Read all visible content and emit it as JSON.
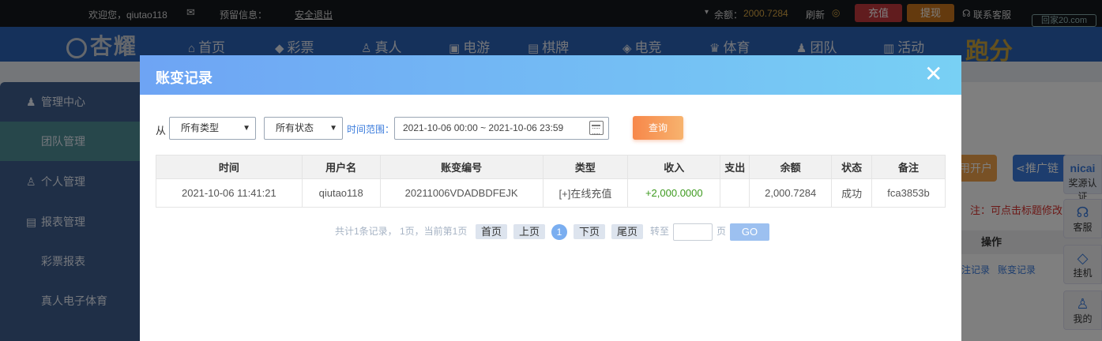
{
  "topbar": {
    "welcome": "欢迎您，qiutao118",
    "reserved_info": "预留信息：",
    "logout": "安全退出",
    "balance_label": "余额：",
    "balance_value": "2000.7284",
    "refresh": "刷新",
    "recharge": "充值",
    "withdraw": "提现",
    "support": "联系客服",
    "watermark": "回家20.com"
  },
  "nav": {
    "logo": "杏耀",
    "items": [
      {
        "label": "首页",
        "icon": "home-icon"
      },
      {
        "label": "彩票",
        "icon": "lottery-icon"
      },
      {
        "label": "真人",
        "icon": "live-icon"
      },
      {
        "label": "电游",
        "icon": "slots-icon"
      },
      {
        "label": "棋牌",
        "icon": "cards-icon"
      },
      {
        "label": "电竞",
        "icon": "gamepad-icon"
      },
      {
        "label": "体育",
        "icon": "trophy-icon"
      },
      {
        "label": "团队",
        "icon": "team-icon"
      },
      {
        "label": "活动",
        "icon": "gift-icon"
      }
    ],
    "run_score": "跑分"
  },
  "sidebar": {
    "items": [
      {
        "label": "管理中心",
        "icon": "users-icon"
      },
      {
        "label": "团队管理",
        "icon": ""
      },
      {
        "label": "个人管理",
        "icon": "user-icon"
      },
      {
        "label": "报表管理",
        "icon": "report-icon"
      },
      {
        "label": "彩票报表",
        "icon": ""
      },
      {
        "label": "真人电子体育",
        "icon": ""
      }
    ]
  },
  "background": {
    "open_account": "用开户",
    "promo": "推广链",
    "note": "注：可点击标题修改",
    "operation_header": "操作",
    "op_link_1": "注记录",
    "op_link_2": "账变记录"
  },
  "floatbar": {
    "items": [
      {
        "label": "奖源认证",
        "icon": "nicai-icon",
        "title": "nicai"
      },
      {
        "label": "客服",
        "icon": "headset-icon"
      },
      {
        "label": "挂机",
        "icon": "diamond-icon"
      },
      {
        "label": "我的",
        "icon": "person-icon"
      }
    ]
  },
  "modal": {
    "title": "账变记录",
    "filter": {
      "from_label": "从",
      "type_select": "所有类型",
      "status_select": "所有状态",
      "time_range_label": "时间范围：",
      "date_range": "2021-10-06 00:00 ~ 2021-10-06 23:59",
      "query_button": "查询"
    },
    "table": {
      "headers": [
        "时间",
        "用户名",
        "账变编号",
        "类型",
        "收入",
        "支出",
        "余额",
        "状态",
        "备注"
      ],
      "rows": [
        [
          "2021-10-06 11:41:21",
          "qiutao118",
          "20211006VDADBDFEJK",
          "[+]在线充值",
          "+2,000.0000",
          "",
          "2,000.7284",
          "成功",
          "fca3853b"
        ]
      ]
    },
    "pager": {
      "summary": "共计1条记录， 1页，当前第1页",
      "first": "首页",
      "prev": "上页",
      "current": "1",
      "next": "下页",
      "last": "尾页",
      "goto_label": "转至",
      "page_unit": "页",
      "go": "GO"
    }
  }
}
